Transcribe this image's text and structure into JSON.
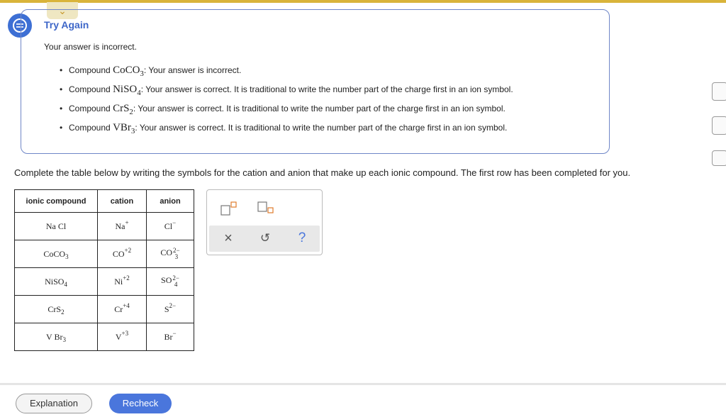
{
  "colors": {
    "accent": "#3d66c8",
    "top_bar": "#d9b43a",
    "recheck": "#4a76dc"
  },
  "feedback": {
    "title": "Try Again",
    "message": "Your answer is incorrect.",
    "items": [
      {
        "prefix": "Compound",
        "formula": "CoCO",
        "sub": "3",
        "suffix": ": Your answer is incorrect."
      },
      {
        "prefix": "Compound",
        "formula": "NiSO",
        "sub": "4",
        "suffix": ": Your answer is correct. It is traditional to write the number part of the charge first in an ion symbol."
      },
      {
        "prefix": "Compound",
        "formula": "CrS",
        "sub": "2",
        "suffix": ": Your answer is correct. It is traditional to write the number part of the charge first in an ion symbol."
      },
      {
        "prefix": "Compound",
        "formula": "VBr",
        "sub": "3",
        "suffix": ": Your answer is correct. It is traditional to write the number part of the charge first in an ion symbol."
      }
    ]
  },
  "instructions": "Complete the table below by writing the symbols for the cation and anion that make up each ionic compound. The first row has been completed for you.",
  "table": {
    "headers": [
      "ionic compound",
      "cation",
      "anion"
    ],
    "rows": [
      {
        "compound": "Na Cl",
        "compound_sub": "",
        "cation": "Na",
        "cation_charge": "+",
        "anion": "Cl",
        "anion_charge": "−",
        "anion_sub": ""
      },
      {
        "compound": "CoCO",
        "compound_sub": "3",
        "cation": "CO",
        "cation_charge": "+2",
        "anion": "CO",
        "anion_charge": "2−",
        "anion_sub": "3"
      },
      {
        "compound": "NiSO",
        "compound_sub": "4",
        "cation": "Ni",
        "cation_charge": "+2",
        "anion": "SO",
        "anion_charge": "2−",
        "anion_sub": "4"
      },
      {
        "compound": "CrS",
        "compound_sub": "2",
        "cation": "Cr",
        "cation_charge": "+4",
        "anion": "S",
        "anion_charge": "2−",
        "anion_sub": ""
      },
      {
        "compound": "V Br",
        "compound_sub": "3",
        "cation": "V",
        "cation_charge": "+3",
        "anion": "Br",
        "anion_charge": "−",
        "anion_sub": ""
      }
    ]
  },
  "palette": {
    "clear": "×",
    "undo": "↺",
    "help": "?"
  },
  "buttons": {
    "explanation": "Explanation",
    "recheck": "Recheck"
  }
}
